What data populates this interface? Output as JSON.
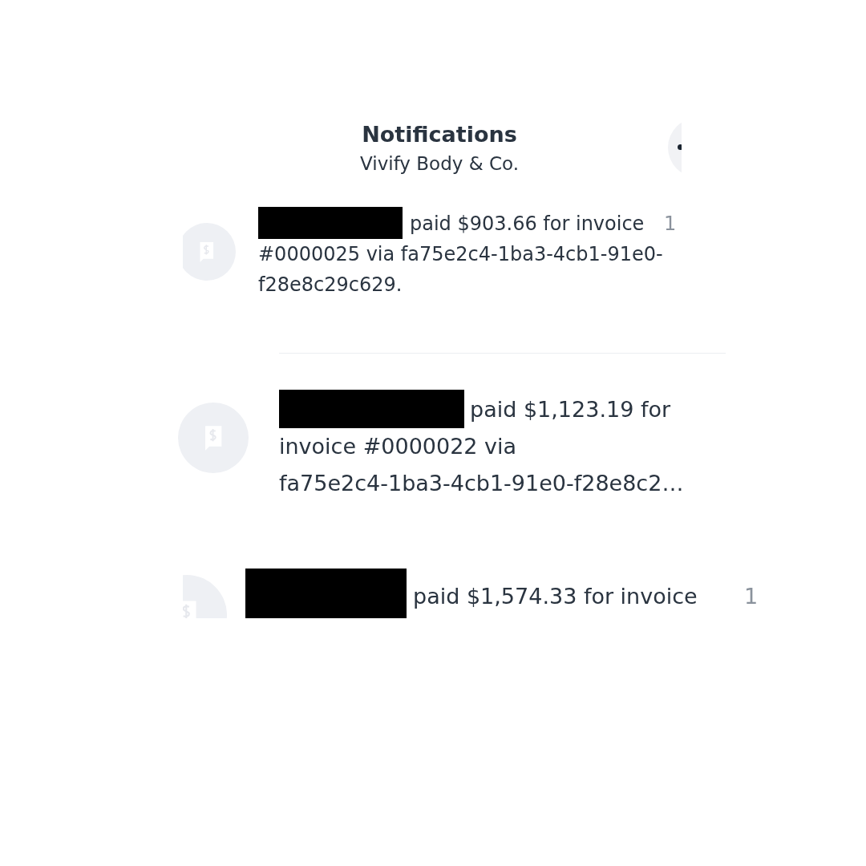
{
  "header": {
    "title": "Notifications",
    "subtitle": "Vivify Body & Co."
  },
  "notifications": [
    {
      "redacted": true,
      "message": "paid $903.66 for invoice #0000025 via fa75e2c4-1ba3-4cb1-91e0-f28e8c29c629.",
      "time": "1"
    },
    {
      "redacted": true,
      "message": "paid $1,123.19 for invoice #0000022 via",
      "reference": "fa75e2c4-1ba3-4cb1-91e0-f28e8c2…"
    },
    {
      "redacted": true,
      "message": "paid $1,574.33 for invoice",
      "time": "1"
    }
  ]
}
